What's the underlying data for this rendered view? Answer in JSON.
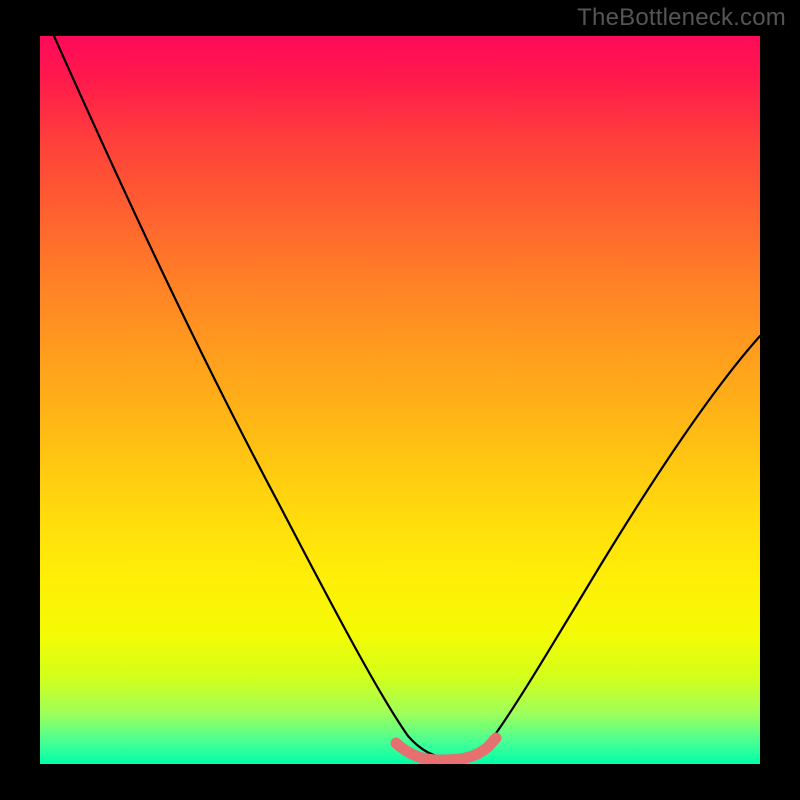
{
  "watermark": "TheBottleneck.com",
  "chart_data": {
    "type": "line",
    "title": "",
    "xlabel": "",
    "ylabel": "",
    "xlim": [
      0,
      100
    ],
    "ylim": [
      0,
      100
    ],
    "series": [
      {
        "name": "bottleneck-curve",
        "x": [
          2,
          10,
          20,
          30,
          40,
          48,
          52,
          56,
          58,
          60,
          62,
          66,
          72,
          80,
          90,
          100
        ],
        "y": [
          100,
          82,
          62,
          42,
          22,
          6,
          2,
          0.5,
          0.5,
          0.5,
          2,
          8,
          18,
          32,
          46,
          58
        ]
      },
      {
        "name": "highlight-band",
        "x": [
          49,
          63
        ],
        "y": [
          3,
          3
        ]
      }
    ],
    "gradient_stops": [
      {
        "pos": 0,
        "color": "#ff0a5a"
      },
      {
        "pos": 24,
        "color": "#ff6030"
      },
      {
        "pos": 54,
        "color": "#ffba15"
      },
      {
        "pos": 82,
        "color": "#f4fb04"
      },
      {
        "pos": 100,
        "color": "#00ffa8"
      }
    ]
  }
}
